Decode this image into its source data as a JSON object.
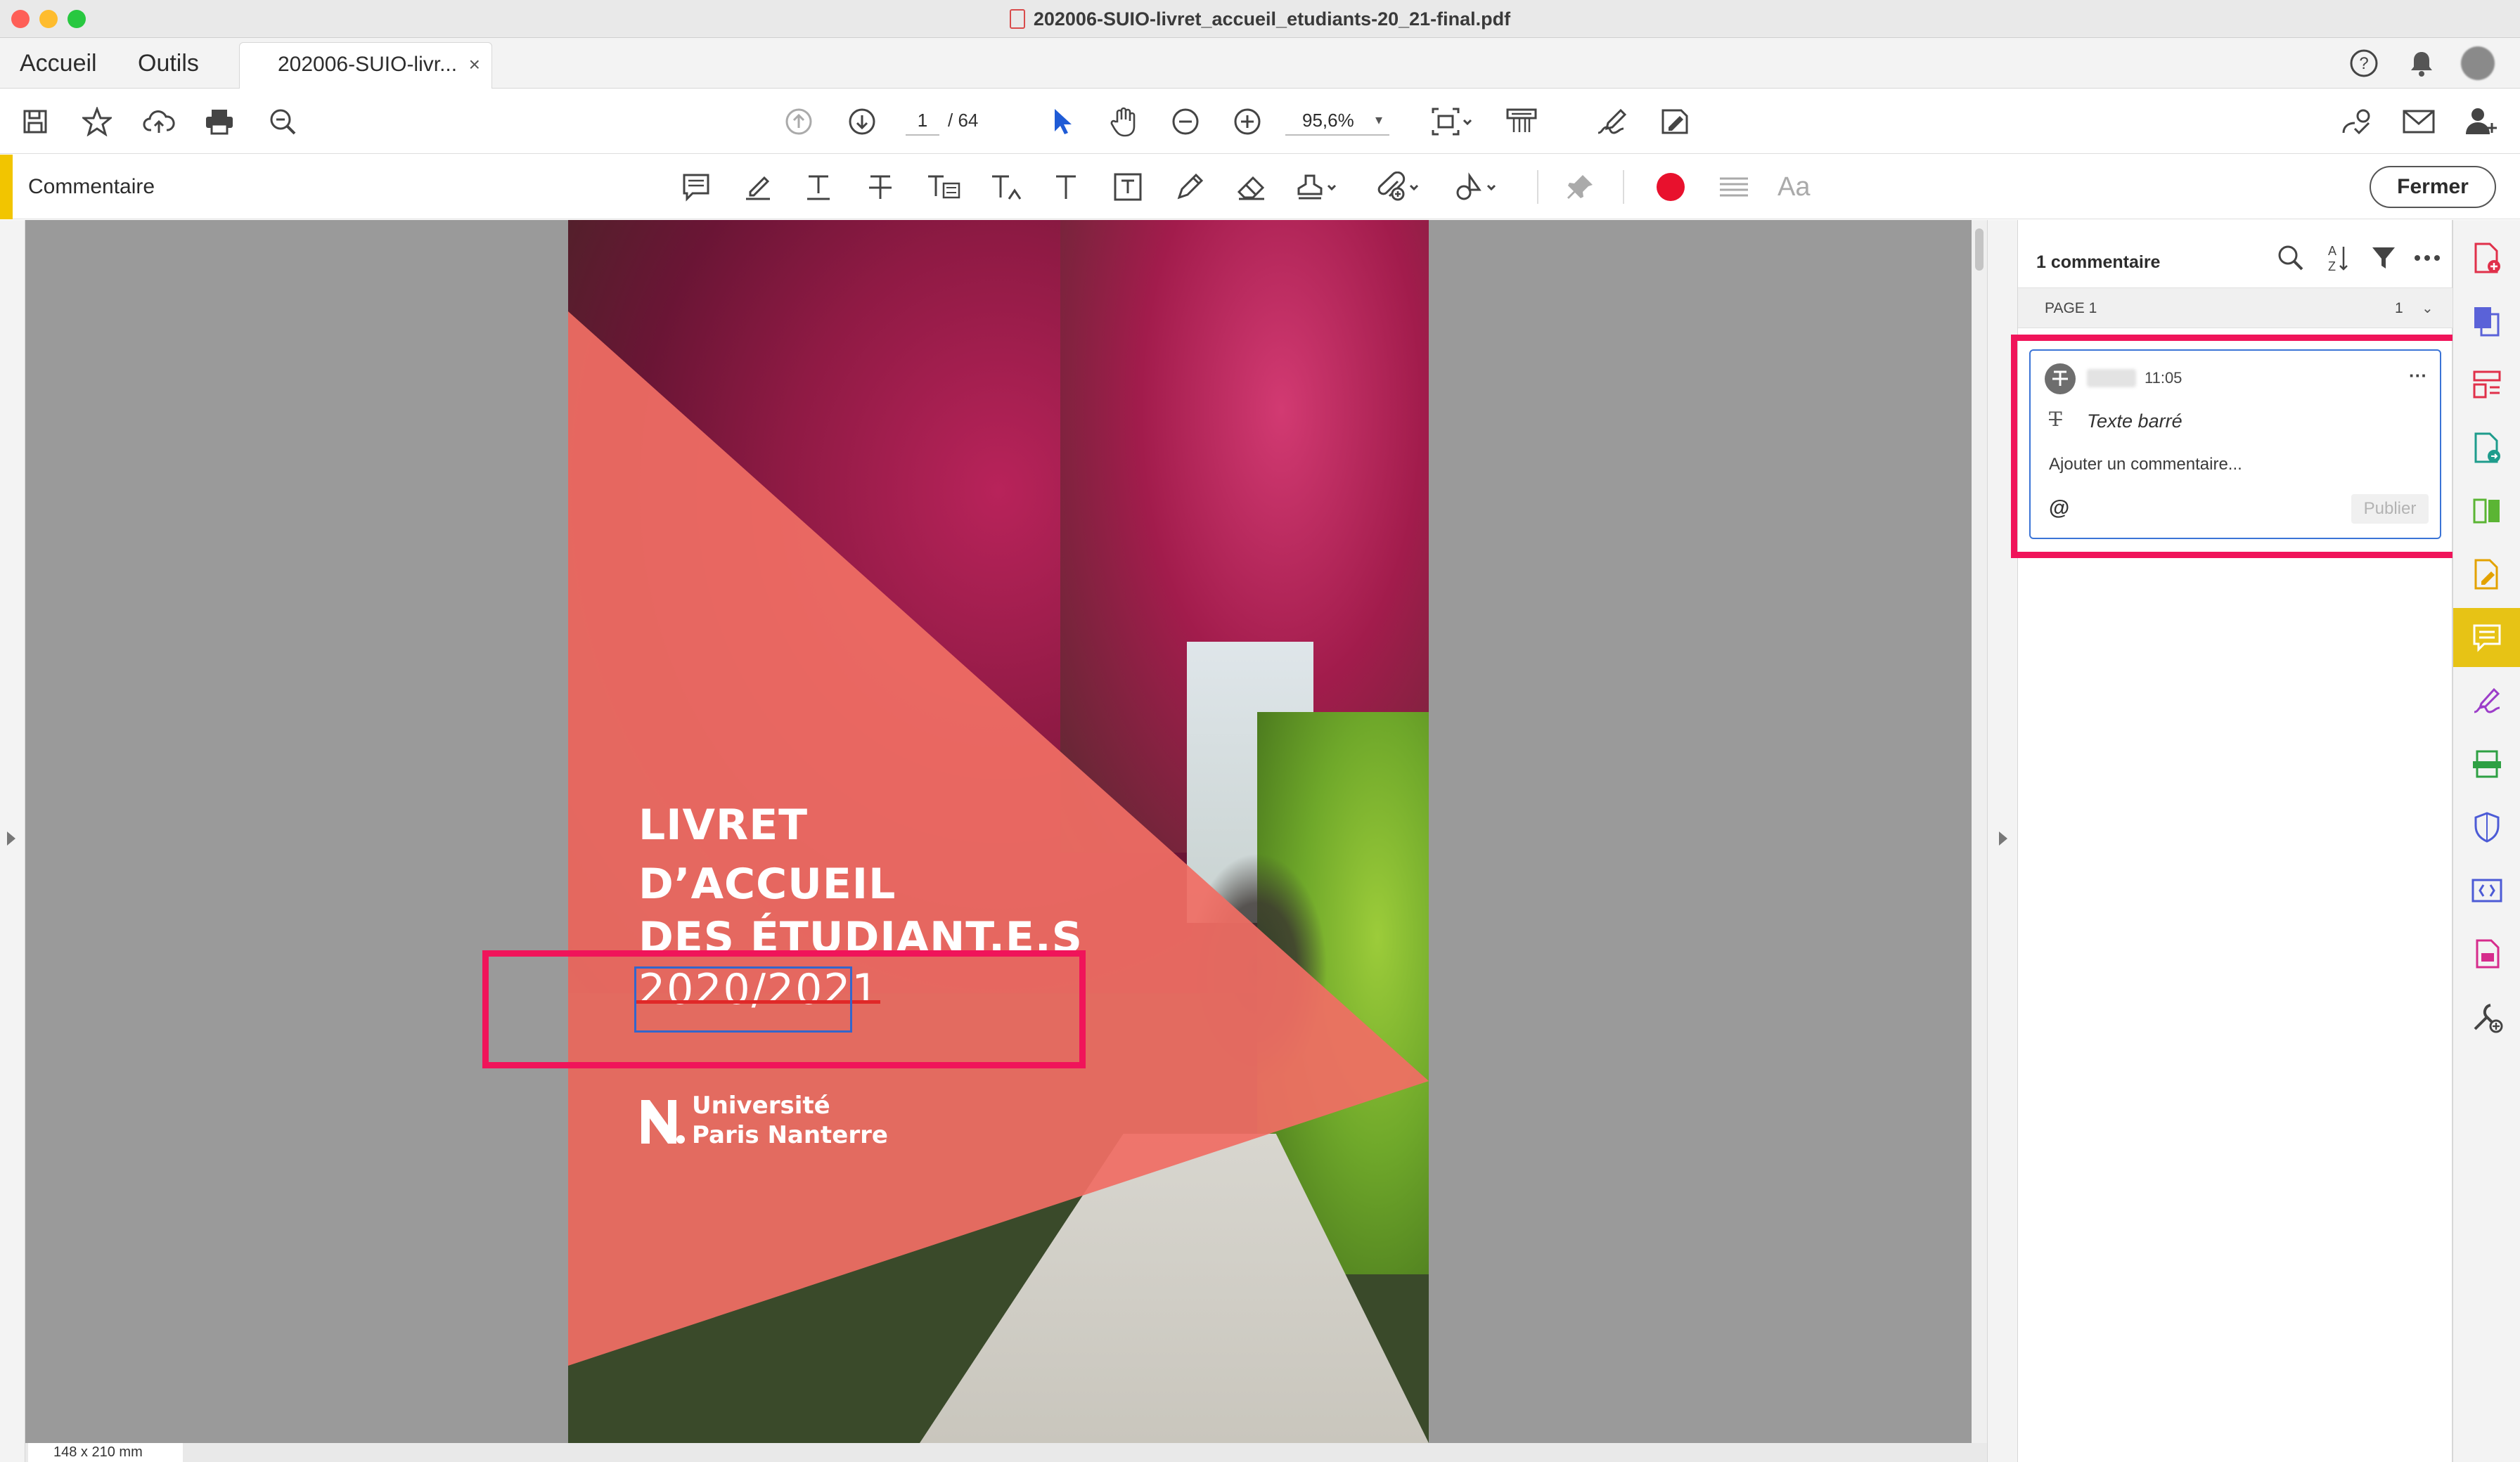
{
  "window": {
    "title": "202006-SUIO-livret_accueil_etudiants-20_21-final.pdf",
    "traffic_colors": {
      "close": "#fe5f57",
      "minimize": "#febc2e",
      "zoom": "#28c840"
    }
  },
  "nav": {
    "home_label": "Accueil",
    "tools_label": "Outils",
    "doc_tab_label": "202006-SUIO-livr...",
    "doc_tab_close": "×"
  },
  "toolbar": {
    "page_current": "1",
    "page_total": "/ 64",
    "zoom_value": "95,6%",
    "zoom_caret": "▾",
    "left_icons": [
      "save-icon",
      "star-icon",
      "cloud-upload-icon",
      "print-icon",
      "zoom-search-icon"
    ],
    "center_icons": [
      "page-up-icon",
      "page-down-icon",
      "select-cursor-icon",
      "hand-icon",
      "zoom-out-icon",
      "zoom-in-icon",
      "page-fit-icon",
      "scroll-mode-icon",
      "sign-icon",
      "edit-form-icon"
    ],
    "right_icons": [
      "share-link-icon",
      "email-icon",
      "add-user-icon"
    ]
  },
  "comment_bar": {
    "label": "Commentaire",
    "accent_color": "#f2c500",
    "close_label": "Fermer",
    "font_label": "Aa",
    "color_swatch": "#e8112d",
    "tool_icons": [
      "sticky-note-icon",
      "highlight-icon",
      "underline-icon",
      "strikethrough-icon",
      "replace-text-icon",
      "insert-text-icon",
      "add-text-icon",
      "text-box-icon",
      "pencil-icon",
      "eraser-icon",
      "stamp-icon",
      "attach-icon",
      "shapes-icon",
      "pin-icon",
      "line-style-icon"
    ]
  },
  "document": {
    "cover_title": [
      "LIVRET",
      "D’ACCUEIL",
      "DES ÉTUDIANT.E.S"
    ],
    "cover_year": "2020/2021",
    "university_line1": "Université",
    "university_line2": "Paris Nanterre",
    "triangle_color": "#f06e64",
    "page_size": "148 x 210 mm"
  },
  "comments_panel": {
    "count_label": "1 commentaire",
    "page_label": "PAGE 1",
    "page_count": "1",
    "page_chevron": "⌄",
    "comment": {
      "time": "11:05",
      "more": "···",
      "type_icon": "T",
      "type": "Texte barré",
      "placeholder": "Ajouter un commentaire...",
      "mention": "@",
      "publish_label": "Publier"
    }
  },
  "annotation_highlight_color": "#f0145a",
  "right_rail": {
    "items": [
      "create-pdf-icon",
      "combine-files-icon",
      "organize-pages-icon",
      "export-pdf-icon",
      "compare-icon",
      "edit-pdf-icon",
      "comment-icon",
      "fill-sign-icon",
      "scan-ocr-icon",
      "protect-icon",
      "accessibility-icon",
      "redact-icon",
      "more-tools-icon"
    ],
    "active": "comment-icon"
  }
}
